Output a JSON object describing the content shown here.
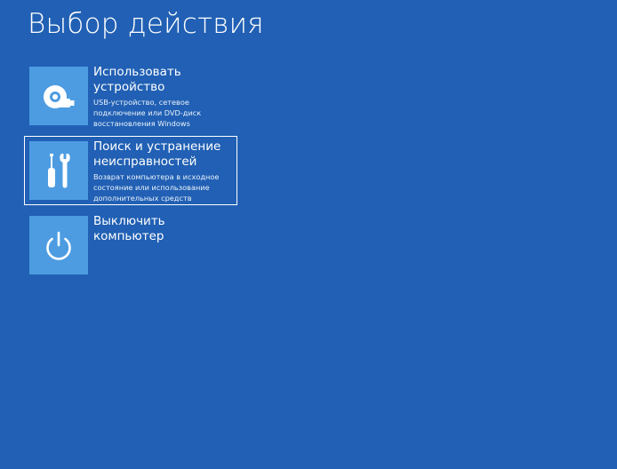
{
  "page": {
    "title": "Выбор действия"
  },
  "colors": {
    "background": "#2160b4",
    "tile": "#4d9ce2",
    "text": "#ffffff"
  },
  "options": [
    {
      "icon": "usb-disc-icon",
      "title_lines": [
        "Использовать",
        "устройство"
      ],
      "desc_lines": [
        "USB-устройство, сетевое",
        "подключение или DVD-диск",
        "восстановления Windows"
      ]
    },
    {
      "icon": "tools-icon",
      "title_lines": [
        "Поиск и устранение",
        "неисправностей"
      ],
      "desc_lines": [
        "Возврат компьютера в исходное",
        "состояние или использование",
        "дополнительных средств"
      ],
      "selected": true
    },
    {
      "icon": "power-icon",
      "title_lines": [
        "Выключить",
        "компьютер"
      ],
      "desc_lines": []
    }
  ]
}
